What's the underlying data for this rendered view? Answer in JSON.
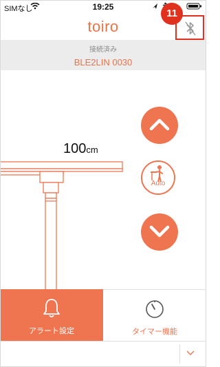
{
  "status": {
    "carrier": "SIMなし",
    "time": "19:25"
  },
  "header": {
    "logo": "toiro",
    "badge": "11"
  },
  "connection": {
    "state": "接続済み",
    "device": "BLE2LIN 0030"
  },
  "desk": {
    "height_value": "100",
    "height_unit": "cm"
  },
  "controls": {
    "auto_label": "Auto"
  },
  "tabs": [
    {
      "label": "アラート設定",
      "icon": "bell-icon"
    },
    {
      "label": "タイマー機能",
      "icon": "timer-icon"
    }
  ],
  "colors": {
    "accent": "#ee7550",
    "highlight": "#e0301e"
  }
}
